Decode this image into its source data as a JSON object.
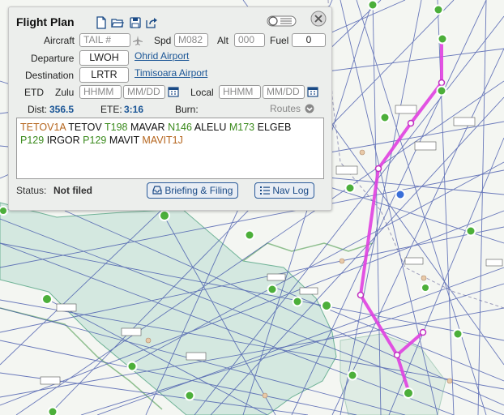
{
  "panel": {
    "title": "Flight Plan",
    "icons": [
      "new-file-icon",
      "open-folder-icon",
      "save-icon",
      "share-icon",
      "toggle-switch-icon",
      "close-icon"
    ],
    "aircraft": {
      "label": "Aircraft",
      "placeholder": "TAIL #"
    },
    "speed": {
      "label": "Spd",
      "placeholder": "M082"
    },
    "altitude": {
      "label": "Alt",
      "placeholder": "000"
    },
    "fuel": {
      "label": "Fuel",
      "value": "0"
    },
    "departure": {
      "label": "Departure",
      "code": "LWOH",
      "name": "Ohrid Airport"
    },
    "destination": {
      "label": "Destination",
      "code": "LRTR",
      "name": "Timisoara Airport"
    },
    "etd": {
      "label": "ETD",
      "zulu_label": "Zulu",
      "zulu_time_placeholder": "HHMM",
      "zulu_date_placeholder": "MM/DD",
      "local_label": "Local",
      "local_time_placeholder": "HHMM",
      "local_date_placeholder": "MM/DD"
    },
    "stats": {
      "dist_label": "Dist:",
      "dist_value": "356.5",
      "ete_label": "ETE:",
      "ete_value": "3:16",
      "burn_label": "Burn:",
      "routes_label": "Routes"
    },
    "route_line1": [
      {
        "t": "TETOV1A",
        "k": "proc"
      },
      {
        "t": "TETOV",
        "k": "fix"
      },
      {
        "t": "T198",
        "k": "awy"
      },
      {
        "t": "MAVAR",
        "k": "fix"
      },
      {
        "t": "N146",
        "k": "awy"
      },
      {
        "t": "ALELU",
        "k": "fix"
      },
      {
        "t": "M173",
        "k": "awy"
      },
      {
        "t": "ELGEB",
        "k": "fix"
      }
    ],
    "route_line2": [
      {
        "t": "P129",
        "k": "awy"
      },
      {
        "t": "IRGOR",
        "k": "fix"
      },
      {
        "t": "P129",
        "k": "awy"
      },
      {
        "t": "MAVIT",
        "k": "fix"
      },
      {
        "t": "MAVIT1J",
        "k": "proc"
      }
    ],
    "status": {
      "label": "Status:",
      "value": "Not filed"
    },
    "buttons": {
      "briefing": "Briefing & Filing",
      "navlog": "Nav Log"
    },
    "colors": {
      "procedure": "#b5651d",
      "airway": "#3a8a1c",
      "link": "#1a5596",
      "route_line": "#e040e0"
    }
  }
}
